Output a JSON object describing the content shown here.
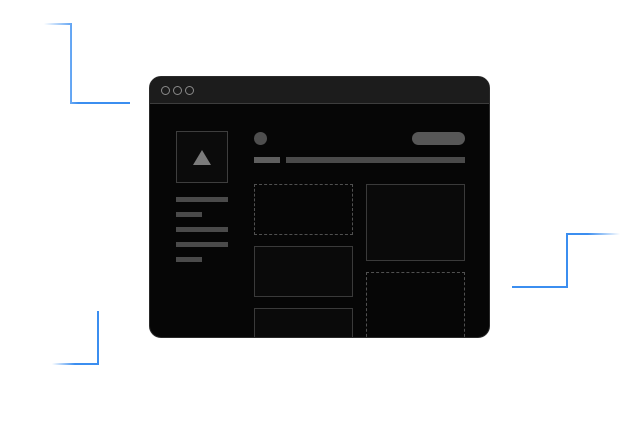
{
  "window": {
    "titlebar_controls": [
      "circle",
      "circle",
      "circle"
    ]
  },
  "sidebar": {
    "logo_icon": "triangle-icon",
    "line_count": 5
  },
  "content": {
    "panels": [
      {
        "style": "dashed"
      },
      {
        "style": "solid"
      },
      {
        "style": "solid"
      },
      {
        "style": "solid"
      },
      {
        "style": "dashed"
      }
    ]
  },
  "colors": {
    "accent": "#3b8ef0",
    "window_bg": "#060606",
    "titlebar_bg": "#1c1c1c",
    "placeholder": "#4a4a4a"
  }
}
